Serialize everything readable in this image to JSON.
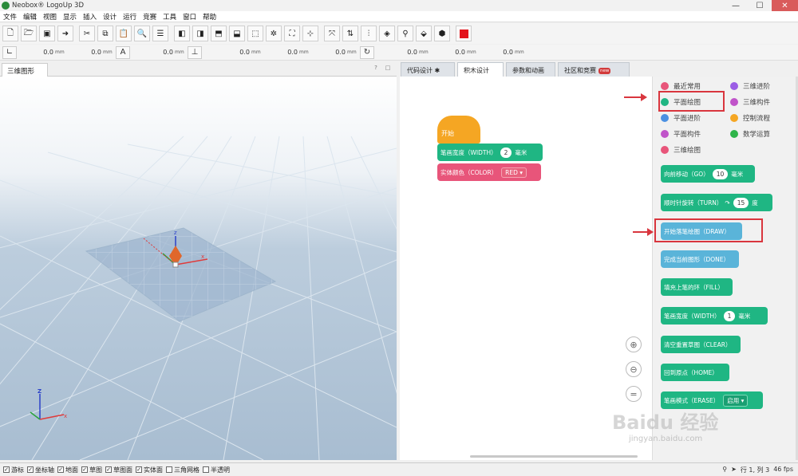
{
  "app": {
    "title": "Neobox® LogoUp 3D"
  },
  "window_controls": {
    "minimize": "—",
    "maximize": "☐",
    "close": "✕"
  },
  "menu": [
    "文件",
    "编辑",
    "视图",
    "显示",
    "插入",
    "设计",
    "运行",
    "竞赛",
    "工具",
    "窗口",
    "帮助"
  ],
  "toolbar2": {
    "v1": "0.0",
    "v2": "0.0",
    "v3": "0.0",
    "v4": "0.0",
    "v5": "0.0",
    "v6": "0.0",
    "v7": "0.0",
    "v8": "0.0",
    "v9": "0.0",
    "unit": "mm"
  },
  "left_panel": {
    "tab": "三维图形",
    "help": "?",
    "restore": "□"
  },
  "right_tabs": [
    "代码设计 ✱",
    "积木设计",
    "参数和动画",
    "社区和竞赛"
  ],
  "new_badge": "new",
  "categories": [
    {
      "label": "最近常用",
      "color": "#e8557a"
    },
    {
      "label": "三维进阶",
      "color": "#9b5de5"
    },
    {
      "label": "平面绘图",
      "color": "#1fb683"
    },
    {
      "label": "三维构件",
      "color": "#c054c9"
    },
    {
      "label": "平面进阶",
      "color": "#4a90e2"
    },
    {
      "label": "控制流程",
      "color": "#f5a623"
    },
    {
      "label": "平面构件",
      "color": "#c054c9"
    },
    {
      "label": "数学运算",
      "color": "#2fb54a"
    },
    {
      "label": "三维绘图",
      "color": "#e8557a"
    }
  ],
  "workspace": {
    "hat": "开始",
    "width_block": {
      "label": "笔画宽度（WIDTH）",
      "value": "2",
      "unit": "毫米"
    },
    "color_block": {
      "label": "实体颜色（COLOR）",
      "value": "RED"
    }
  },
  "flyout_blocks": [
    {
      "label": "向前移动（GO）",
      "value": "10",
      "unit": "毫米",
      "turn": ""
    },
    {
      "label": "顺时针旋转（TURN）",
      "value": "15",
      "unit": "度",
      "turn": "↷"
    },
    {
      "label": "开始落笔绘图（DRAW）",
      "value": "",
      "unit": "",
      "turn": ""
    },
    {
      "label": "完成当前图形（DONE）",
      "value": "",
      "unit": "",
      "turn": ""
    },
    {
      "label": "填充上笔的环（FILL）",
      "value": "",
      "unit": "",
      "turn": ""
    },
    {
      "label": "笔画宽度（WIDTH）",
      "value": "1",
      "unit": "毫米",
      "turn": ""
    },
    {
      "label": "清空重置草图（CLEAR）",
      "value": "",
      "unit": "",
      "turn": ""
    },
    {
      "label": "回到原点（HOME）",
      "value": "",
      "unit": "",
      "turn": ""
    },
    {
      "label": "笔画模式（ERASE）",
      "value": "启用",
      "unit": "",
      "turn": ""
    }
  ],
  "zoom": {
    "in": "⊕",
    "out": "⊖",
    "reset": "="
  },
  "statusbar": {
    "checks": [
      {
        "label": "游标",
        "checked": true
      },
      {
        "label": "坐标轴",
        "checked": true
      },
      {
        "label": "地面",
        "checked": true
      },
      {
        "label": "草图",
        "checked": true
      },
      {
        "label": "草图面",
        "checked": true
      },
      {
        "label": "实体面",
        "checked": true
      },
      {
        "label": "三角网格",
        "checked": false
      },
      {
        "label": "半透明",
        "checked": false
      }
    ],
    "position": "行 1, 列 3",
    "fps": "46 fps"
  },
  "watermark": {
    "main": "Baidu 经验",
    "sub": "jingyan.baidu.com"
  }
}
